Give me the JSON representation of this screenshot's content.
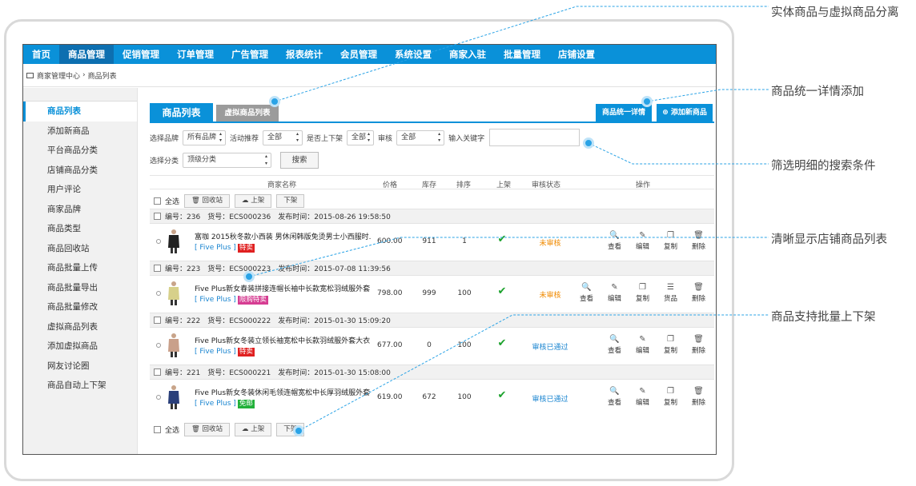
{
  "nav": [
    "首页",
    "商品管理",
    "促销管理",
    "订单管理",
    "广告管理",
    "报表统计",
    "会员管理",
    "系统设置",
    "商家入驻",
    "批量管理",
    "店铺设置"
  ],
  "breadcrumb": {
    "home": "商家管理中心",
    "sep": "›",
    "current": "商品列表"
  },
  "sidebar": [
    "商品列表",
    "添加新商品",
    "平台商品分类",
    "店铺商品分类",
    "用户评论",
    "商家品牌",
    "商品类型",
    "商品回收站",
    "商品批量上传",
    "商品批量导出",
    "商品批量修改",
    "虚拟商品列表",
    "添加虚拟商品",
    "网友讨论圈",
    "商品自动上下架"
  ],
  "tabs": {
    "active": "商品列表",
    "other": "虚拟商品列表"
  },
  "buttons": {
    "unified_detail": "商品统一详情",
    "add_product": "添加新商品",
    "search": "搜索"
  },
  "filters": {
    "brand_label": "选择品牌",
    "brand_value": "所有品牌",
    "promo_label": "活动推荐",
    "promo_value": "全部",
    "onsale_label": "是否上下架",
    "onsale_value": "全部",
    "audit_label": "审核",
    "audit_value": "全部",
    "keyword_label": "输入关键字",
    "keyword_value": "",
    "category_label": "选择分类",
    "category_value": "顶级分类"
  },
  "columns": {
    "name": "商家名称",
    "price": "价格",
    "stock": "库存",
    "sort": "排序",
    "onsale": "上架",
    "audit": "审核状态",
    "ops": "操作"
  },
  "batch": {
    "select_all": "全选",
    "recycle": "回收站",
    "onshelf": "上架",
    "offshelf": "下架"
  },
  "ops_labels": {
    "view": "查看",
    "edit": "编辑",
    "copy": "复制",
    "goods": "货品",
    "delete": "删除"
  },
  "rows": [
    {
      "no": "编号：236",
      "sku": "货号：ECS000236",
      "time": "发布时间：2015-08-26 19:58:50",
      "name": "富咖 2015秋冬款小西装 男休闲韩版免烫男士小西服时...",
      "brand": "[ Five Plus ]",
      "tag": "特卖",
      "tag_color": "#e02020",
      "price": "600.00",
      "stock": "911",
      "sort": "1",
      "audit": "未审核",
      "audit_color": "#f08a00"
    },
    {
      "no": "编号：223",
      "sku": "货号：ECS000223",
      "time": "发布时间：2015-07-08 11:39:56",
      "name": "Five Plus新女春装拼接连帽长袖中长款宽松羽绒服外套...",
      "brand": "[ Five Plus ]",
      "tag": "限购特卖",
      "tag_color": "#d63d92",
      "price": "798.00",
      "stock": "999",
      "sort": "100",
      "audit": "未审核",
      "audit_color": "#f08a00"
    },
    {
      "no": "编号：222",
      "sku": "货号：ECS000222",
      "time": "发布时间：2015-01-30 15:09:20",
      "name": "Five Plus新女冬装立领长袖宽松中长款羽绒服外套大衣...",
      "brand": "[ Five Plus ]",
      "tag": "特卖",
      "tag_color": "#e02020",
      "price": "677.00",
      "stock": "0",
      "sort": "100",
      "audit": "审核已通过",
      "audit_color": "#1a85d0"
    },
    {
      "no": "编号：221",
      "sku": "货号：ECS000221",
      "time": "发布时间：2015-01-30 15:08:00",
      "name": "Five Plus新女冬装休闲毛领连帽宽松中长厚羽绒服外套...",
      "brand": "[ Five Plus ]",
      "tag": "免邮",
      "tag_color": "#22b13a",
      "price": "619.00",
      "stock": "672",
      "sort": "100",
      "audit": "审核已通过",
      "audit_color": "#1a85d0"
    }
  ],
  "annotations": [
    "实体商品与虚拟商品分离",
    "商品统一详情添加",
    "筛选明细的搜索条件",
    "清晰显示店铺商品列表",
    "商品支持批量上下架"
  ],
  "colors": {
    "accent": "#0a91d9",
    "callout": "#2aa3e6"
  }
}
